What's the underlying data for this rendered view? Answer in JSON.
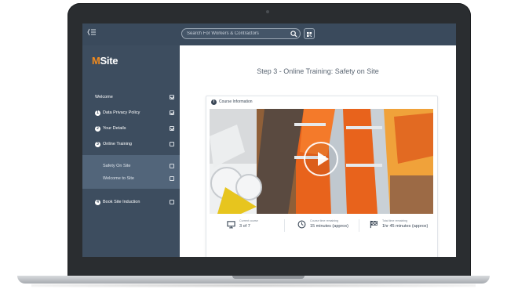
{
  "app": {
    "search_placeholder": "Search For Workers & Contractors",
    "logo_prefix": "M",
    "logo_text": "Site"
  },
  "sidebar": {
    "welcome": "Welcome",
    "items": [
      {
        "number": "1",
        "label": "Data Privacy Policy",
        "status": "done"
      },
      {
        "number": "2",
        "label": "Your Details",
        "status": "done"
      },
      {
        "number": "3",
        "label": "Online Training",
        "status": "pending"
      },
      {
        "number": "4",
        "label": "Book Site Induction",
        "status": "pending"
      }
    ],
    "sub_items": [
      {
        "label": "Safety On Site",
        "status": "pending"
      },
      {
        "label": "Welcome to Site",
        "status": "pending"
      }
    ]
  },
  "main": {
    "title": "Step 3 - Online Training: Safety on Site",
    "card_header": "Course Information",
    "stats": [
      {
        "icon": "monitor-icon",
        "caption": "Current course",
        "value": "3 of 7"
      },
      {
        "icon": "clock-icon",
        "caption": "Course time remaining",
        "value": "15 minutes (approx)"
      },
      {
        "icon": "flag-icon",
        "caption": "Total time remaining",
        "value": "1hr 45 minutes (approx)"
      }
    ]
  },
  "colors": {
    "topbar": "#3a4a5c",
    "sidebar": "#3d4d5f",
    "sub_panel": "#52657a",
    "accent": "#f28b1e"
  }
}
